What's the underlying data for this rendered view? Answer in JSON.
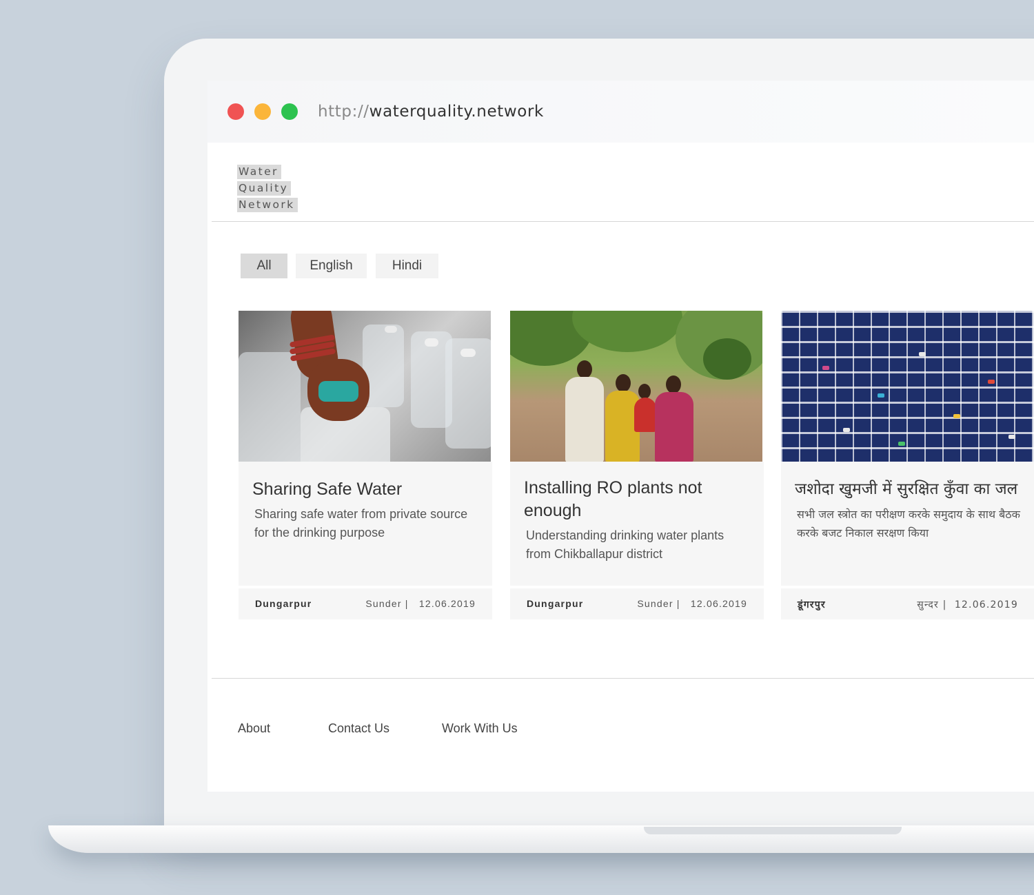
{
  "browser": {
    "url_protocol": "http://",
    "url_host": "waterquality.network"
  },
  "logo": [
    "Water",
    "Quality",
    "Network"
  ],
  "filters": [
    {
      "label": "All",
      "active": true
    },
    {
      "label": "English",
      "active": false
    },
    {
      "label": "Hindi",
      "active": false
    }
  ],
  "cards": [
    {
      "title": "Sharing Safe Water",
      "description": "Sharing safe water from private source for the drinking purpose",
      "location": "Dungarpur",
      "author": "Sunder |",
      "date": "12.06.2019"
    },
    {
      "title": "Installing RO plants not enough",
      "description": "Understanding drinking water plants from Chikballapur district",
      "location": "Dungarpur",
      "author": "Sunder |",
      "date": "12.06.2019"
    },
    {
      "title": "जशोदा खुमजी में सुरक्षित कुँवा का जल",
      "description": "सभी जल स्त्रोत का परीक्षण करके समुदाय के साथ बैठक करके बजट निकाल सरक्षण किया",
      "location": "डूंगरपुर",
      "author": "सुन्दर |",
      "date": "12.06.2019"
    }
  ],
  "footer": {
    "about": "About",
    "contact": "Contact Us",
    "work": "Work With Us"
  },
  "colors": {
    "background": "#c8d2dc",
    "dot_red": "#f05353",
    "dot_yellow": "#fbb53a",
    "dot_green": "#2dc24f",
    "filter_active": "#dadada",
    "card_bg": "#f6f6f6"
  }
}
